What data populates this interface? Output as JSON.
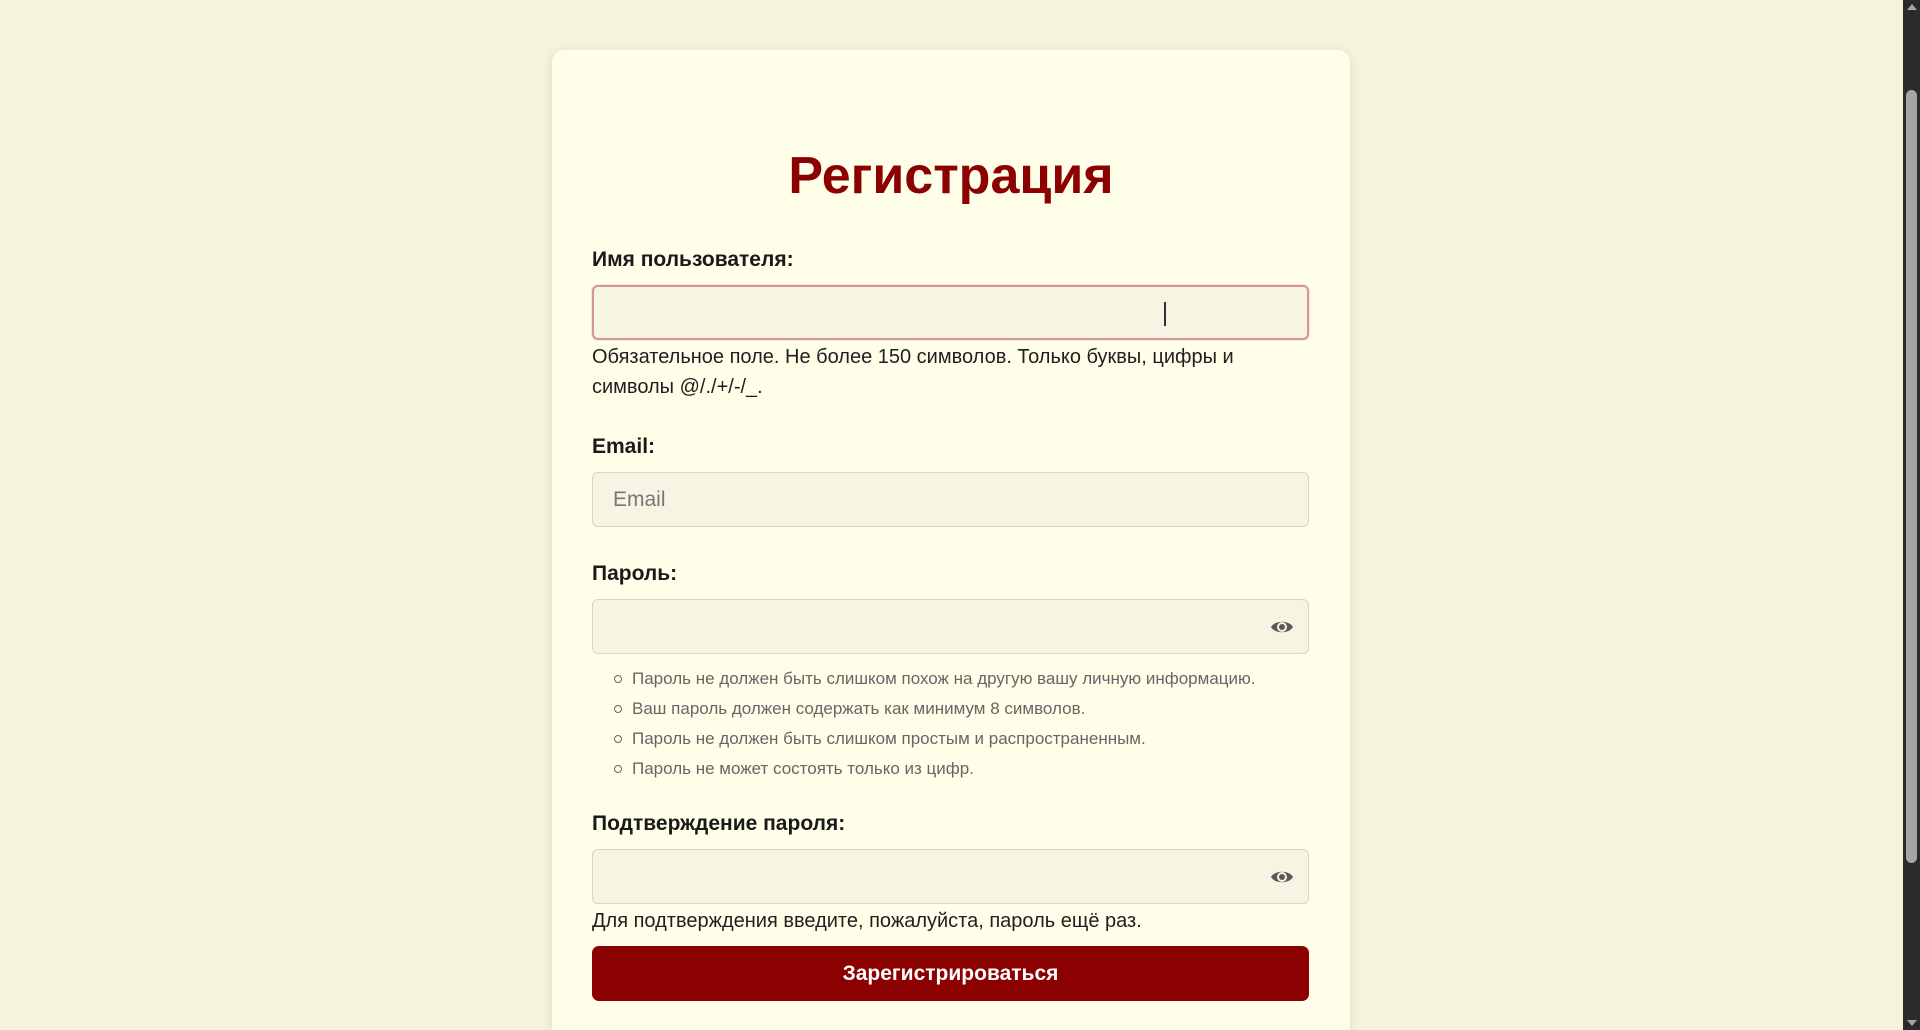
{
  "form": {
    "title": "Регистрация",
    "username": {
      "label": "Имя пользователя:",
      "value": "",
      "help": "Обязательное поле. Не более 150 символов. Только буквы, цифры и символы @/./+/-/_."
    },
    "email": {
      "label": "Email:",
      "value": "",
      "placeholder": "Email"
    },
    "password": {
      "label": "Пароль:",
      "value": "",
      "toggle_icon": "eye-icon",
      "rules": [
        "Пароль не должен быть слишком похож на другую вашу личную информацию.",
        "Ваш пароль должен содержать как минимум 8 символов.",
        "Пароль не должен быть слишком простым и распространенным.",
        "Пароль не может состоять только из цифр."
      ]
    },
    "password_confirm": {
      "label": "Подтверждение пароля:",
      "value": "",
      "toggle_icon": "eye-icon",
      "help": "Для подтверждения введите, пожалуйста, пароль ещё раз."
    },
    "submit_label": "Зарегистрироваться"
  },
  "colors": {
    "page_background": "#f5f3dc",
    "card_background": "#fffee8",
    "accent": "#8b0000",
    "input_background": "#f6f4e2",
    "focus_border": "#d69595"
  }
}
